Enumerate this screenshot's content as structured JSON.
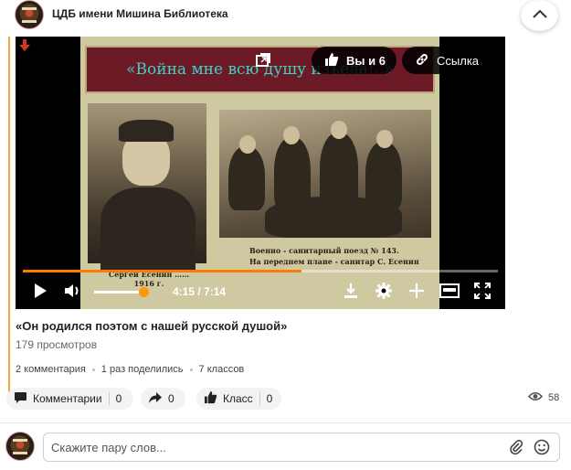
{
  "header": {
    "group_name": "ЦДБ имени Мишина Библиотека"
  },
  "video": {
    "banner_text": "«Война мне всю душу изъела!..»",
    "caption_left": "Сергей Есенин …… 1916 г.",
    "caption_right_line1": "Военно - санитарный поезд № 143.",
    "caption_right_line2": "На переднем плане - санитар С. Есенин",
    "like_pill_label": "Вы и 6",
    "link_pill_label": "Ссылка",
    "current_time": "4:15",
    "duration": "7:14",
    "time_display": "4:15 / 7:14",
    "progress_fraction": 0.587,
    "volume_fraction": 0.9
  },
  "post": {
    "title": "«Он родился поэтом с нашей русской душой»",
    "views": "179 просмотров",
    "stats": [
      "2 комментария",
      "1 раз поделились",
      "7 классов"
    ]
  },
  "actions": {
    "comments_label": "Комментарии",
    "comments_count": "0",
    "share_count": "0",
    "class_label": "Класс",
    "class_count": "0",
    "view_count": "58"
  },
  "comment_box": {
    "placeholder": "Скажите пару слов..."
  },
  "colors": {
    "accent": "#f2a93b",
    "progress": "#ff7a00",
    "banner_bg": "#6d1a27",
    "banner_text": "#40d0c6"
  },
  "icons": [
    "chevron-up-icon",
    "arrow-down-icon",
    "picture-in-picture-icon",
    "thumbs-up-icon",
    "link-icon",
    "play-icon",
    "volume-icon",
    "download-icon",
    "settings-icon",
    "plus-icon",
    "miniplayer-icon",
    "fullscreen-icon",
    "comment-icon",
    "share-arrow-icon",
    "eye-icon",
    "paperclip-icon",
    "smiley-icon"
  ]
}
